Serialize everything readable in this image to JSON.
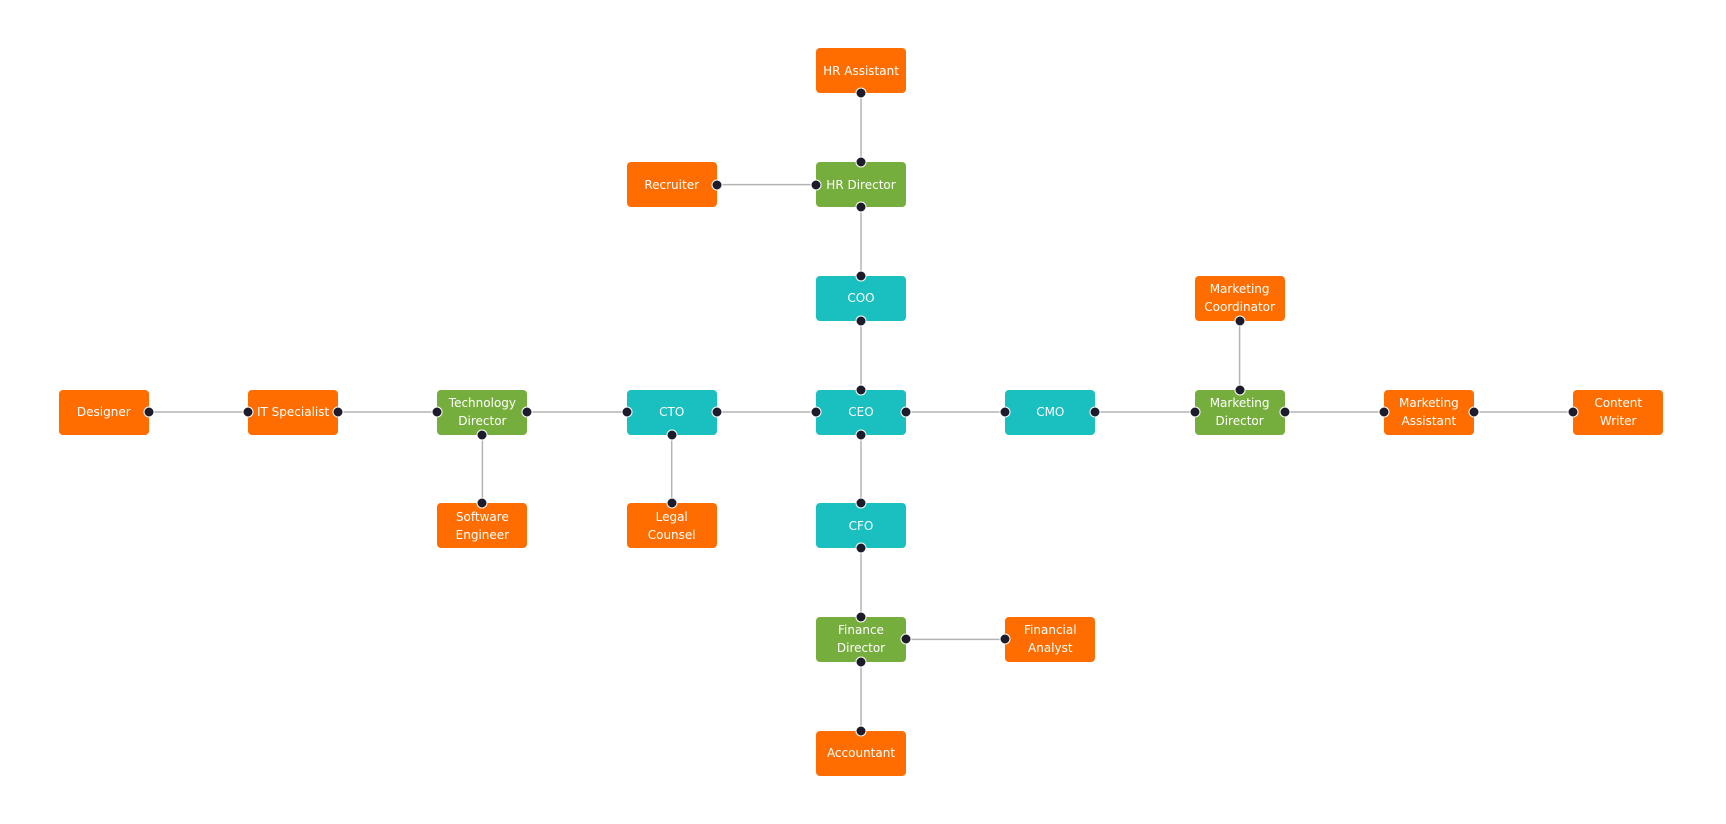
{
  "colors": {
    "executive": "#1ABFBF",
    "director": "#76AE3E",
    "staff": "#FF6D00",
    "edge": "#B4B4B4",
    "port": "#1C1C2C"
  },
  "nodes": [
    {
      "id": "ceo",
      "label": "CEO",
      "level": "executive"
    },
    {
      "id": "coo",
      "label": "COO",
      "level": "executive"
    },
    {
      "id": "cto",
      "label": "CTO",
      "level": "executive"
    },
    {
      "id": "cmo",
      "label": "CMO",
      "level": "executive"
    },
    {
      "id": "cfo",
      "label": "CFO",
      "level": "executive"
    },
    {
      "id": "hrdir",
      "label": "HR Director",
      "level": "director"
    },
    {
      "id": "hrasst",
      "label": "HR Assistant",
      "level": "staff"
    },
    {
      "id": "recruiter",
      "label": "Recruiter",
      "level": "staff"
    },
    {
      "id": "techdir",
      "label": "Technology Director",
      "level": "director"
    },
    {
      "id": "itspec",
      "label": "IT Specialist",
      "level": "staff"
    },
    {
      "id": "designer",
      "label": "Designer",
      "level": "staff"
    },
    {
      "id": "softeng",
      "label": "Software Engineer",
      "level": "staff"
    },
    {
      "id": "legal",
      "label": "Legal Counsel",
      "level": "staff"
    },
    {
      "id": "mktdir",
      "label": "Marketing Director",
      "level": "director"
    },
    {
      "id": "mktcoord",
      "label": "Marketing Coordinator",
      "level": "staff"
    },
    {
      "id": "mktasst",
      "label": "Marketing Assistant",
      "level": "staff"
    },
    {
      "id": "writer",
      "label": "Content Writer",
      "level": "staff"
    },
    {
      "id": "findir",
      "label": "Finance Director",
      "level": "director"
    },
    {
      "id": "analyst",
      "label": "Financial Analyst",
      "level": "staff"
    },
    {
      "id": "accountant",
      "label": "Accountant",
      "level": "staff"
    }
  ],
  "edges": [
    [
      "hrasst",
      "hrdir"
    ],
    [
      "recruiter",
      "hrdir"
    ],
    [
      "hrdir",
      "coo"
    ],
    [
      "coo",
      "ceo"
    ],
    [
      "cto",
      "ceo"
    ],
    [
      "ceo",
      "cmo"
    ],
    [
      "ceo",
      "cfo"
    ],
    [
      "techdir",
      "cto"
    ],
    [
      "cto",
      "legal"
    ],
    [
      "itspec",
      "techdir"
    ],
    [
      "techdir",
      "softeng"
    ],
    [
      "designer",
      "itspec"
    ],
    [
      "cmo",
      "mktdir"
    ],
    [
      "mktcoord",
      "mktdir"
    ],
    [
      "mktdir",
      "mktasst"
    ],
    [
      "mktasst",
      "writer"
    ],
    [
      "cfo",
      "findir"
    ],
    [
      "findir",
      "analyst"
    ],
    [
      "findir",
      "accountant"
    ]
  ]
}
